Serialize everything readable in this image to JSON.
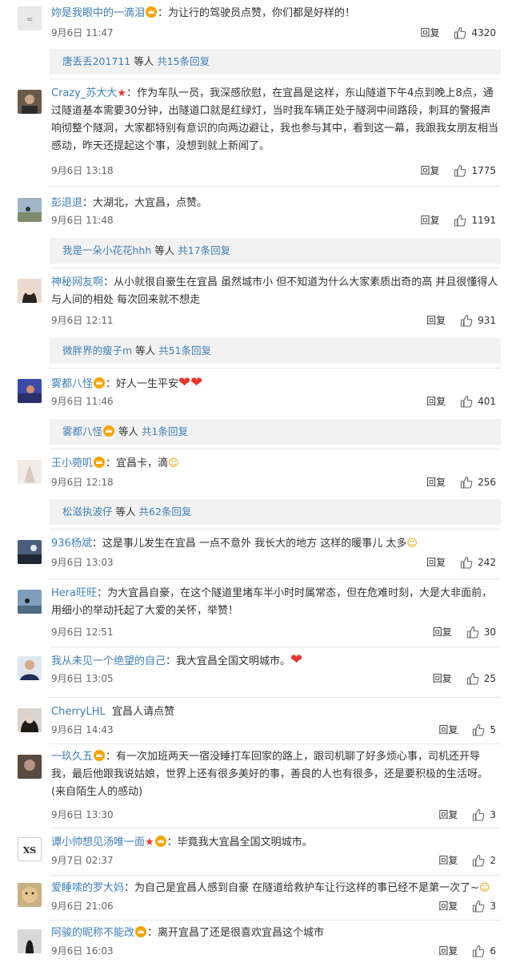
{
  "reply_label": "回复",
  "more_suffix": "等人",
  "comments": [
    {
      "user": "妳是我眼中的一滴泪",
      "text": "：为让行的驾驶员点赞，你们都是好样的！",
      "time": "9月6日 11:47",
      "likes": "4320",
      "more": {
        "users": "唐丢丢201711",
        "count": "共15条回复"
      }
    },
    {
      "user": "Crazy_苏大大",
      "text": "：作为车队一员，我深感欣慰，在宜昌是这样，东山隧道下午4点到晚上8点，通过隧道基本需要30分钟，出隧道口就是红绿灯，当时我车辆正处于隧洞中间路段，刺耳的警报声响彻整个隧洞，大家都特别有意识的向两边避让，我也参与其中，看到这一幕，我跟我女朋友相当感动，昨天还提起这个事，没想到就上新闻了。",
      "time": "9月6日 13:18",
      "likes": "1775"
    },
    {
      "user": "彭退退",
      "text": "：大湖北，大宜昌，点赞。",
      "time": "9月6日 11:48",
      "likes": "1191",
      "more": {
        "users": "我是一朵小花花hhh",
        "count": "共17条回复"
      }
    },
    {
      "user": "神秘网友啊",
      "text": "：从小就很自豪生在宜昌 虽然城市小 但不知道为什么大家素质出奇的高 并且很懂得人与人间的相处 每次回来就不想走",
      "time": "9月6日 12:11",
      "likes": "931",
      "more": {
        "users": "微胖界的瘦子m",
        "count": "共51条回复"
      }
    },
    {
      "user": "雾都八怪",
      "text": "：好人一生平安",
      "time": "9月6日 11:46",
      "likes": "401",
      "more": {
        "users": "雾都八怪",
        "count": "共1条回复"
      }
    },
    {
      "user": "王小菀叽",
      "text": "：宜昌卡，滴",
      "time": "9月6日 12:18",
      "likes": "256",
      "more": {
        "users": "松滋执波仔",
        "count": "共62条回复"
      }
    },
    {
      "user": "936杨斌",
      "text": "：这是事儿发生在宜昌 一点不意外 我长大的地方 这样的暖事儿 太多",
      "time": "9月6日 13:03",
      "likes": "242"
    },
    {
      "user": "Hera旺旺",
      "text": "：为大宜昌自豪，在这个隧道里堵车半小时时属常态，但在危难时刻，大是大非面前，用细小的举动托起了大爱的关怀，举赞！",
      "time": "9月6日 12:51",
      "likes": "30"
    },
    {
      "user": "我从未见一个绝望的自己",
      "text": "：我大宜昌全国文明城市。",
      "time": "9月6日 13:05",
      "likes": "25"
    },
    {
      "user": "CherryLHL",
      "text": "宜昌人请点赞",
      "time": "9月6日 14:43",
      "likes": "5"
    },
    {
      "user": "一玖久五",
      "text": "：有一次加班两天一宿没睡打车回家的路上，跟司机聊了好多烦心事，司机还开导我，最后他跟我说姑娘，世界上还有很多美好的事，善良的人也有很多，还是要积极的生活呀。(来自陌生人的感动)",
      "time": "9月6日 13:30",
      "likes": "3"
    },
    {
      "user": "谭小帅想见汤唯一面",
      "text": "：毕竟我大宜昌全国文明城市。",
      "time": "9月7日 02:37",
      "likes": "2"
    },
    {
      "user": "爱睡嗦的罗大妈",
      "text": "：为自己是宜昌人感到自豪 在隧道给救护车让行这样的事已经不是第一次了~",
      "time": "9月6日 21:06",
      "likes": "3"
    },
    {
      "user": "阿骏的昵称不能改",
      "text": "：离开宜昌了还是很喜欢宜昌这个城市",
      "time": "9月6日 16:03",
      "likes": "6"
    }
  ],
  "colors": {
    "link": "#3f7fb8",
    "bar": "#f2f2f2",
    "heart": "#e8352b"
  }
}
